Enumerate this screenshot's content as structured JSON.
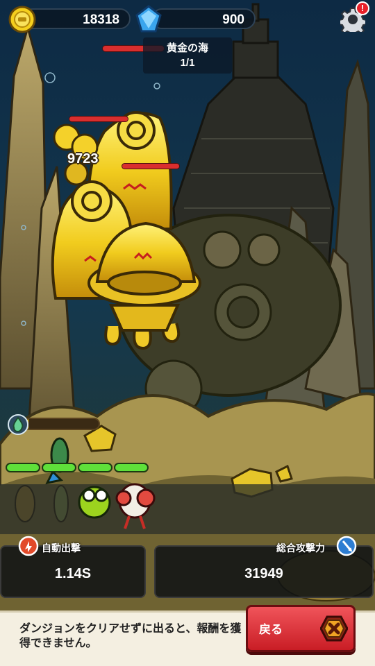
{
  "hud": {
    "gold_amount": "18318",
    "gem_amount": "900",
    "alert_badge": "!"
  },
  "stage": {
    "name": "黄金の海",
    "progress": "1/1"
  },
  "battle": {
    "damage_popup": "9723",
    "charge_fraction": 0.05
  },
  "stats": {
    "auto_attack_label": "自動出撃",
    "auto_attack_value": "1.14S",
    "total_attack_label": "総合攻撃力",
    "total_attack_value": "31949"
  },
  "footer": {
    "notice": "ダンジョンをクリアせずに出ると、報酬を獲得できません。",
    "back_label": "戻る"
  },
  "icons": {
    "gold": "gold-coin-icon",
    "gem": "blue-gem-icon",
    "settings": "gear-icon",
    "close": "close-x-icon"
  },
  "colors": {
    "gold": "#f2d41a",
    "hp_enemy": "#d92e2e",
    "hp_hero": "#5fe03a",
    "back_button": "#e0343c"
  }
}
